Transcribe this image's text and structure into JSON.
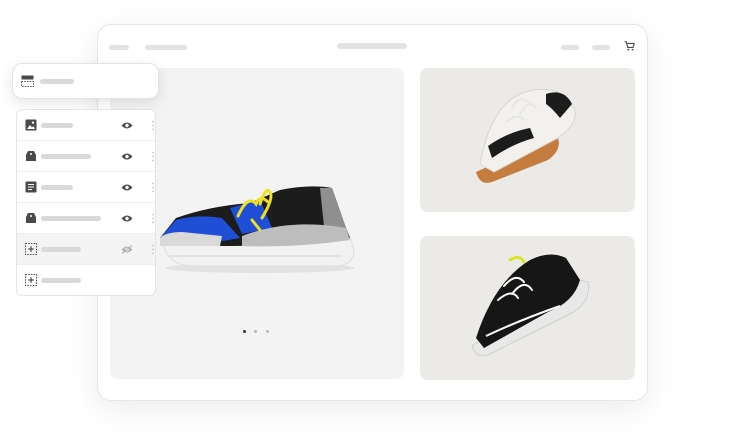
{
  "colors": {
    "page_background": "#ffffff",
    "window_background": "#ffffff",
    "placeholder_bar": "#e2e2e2",
    "main_image_background": "#f3f3f3",
    "side_image_background": "#eceae6",
    "icon_gray": "#4a4a4a",
    "accent_blue": "#1f4fd6",
    "accent_yellow": "#f0e020"
  },
  "header": {
    "nav_left_1": "",
    "nav_left_2": "",
    "title": "",
    "nav_right_1": "",
    "nav_right_2": "",
    "cart_icon": "cart-icon"
  },
  "gallery": {
    "main_image": {
      "subject": "sneaker-black-blue-yellow-laces-icon"
    },
    "side_images": [
      {
        "subject": "sneaker-white-black-gum-sole-icon"
      },
      {
        "subject": "sneaker-black-white-chunky-sole-icon"
      }
    ],
    "pagination": {
      "count": 3,
      "active_index": 0
    }
  },
  "block_selector": {
    "icon": "section-layout-icon",
    "label": ""
  },
  "layers": [
    {
      "icon": "image-icon",
      "label": "",
      "visible": true
    },
    {
      "icon": "tag-icon",
      "label": "",
      "visible": true
    },
    {
      "icon": "text-block-icon",
      "label": "",
      "visible": true
    },
    {
      "icon": "tag-icon",
      "label": "",
      "visible": true
    },
    {
      "icon": "add-block-icon",
      "label": "",
      "visible": false
    },
    {
      "icon": "add-block-icon",
      "label": "",
      "visible": null
    }
  ]
}
